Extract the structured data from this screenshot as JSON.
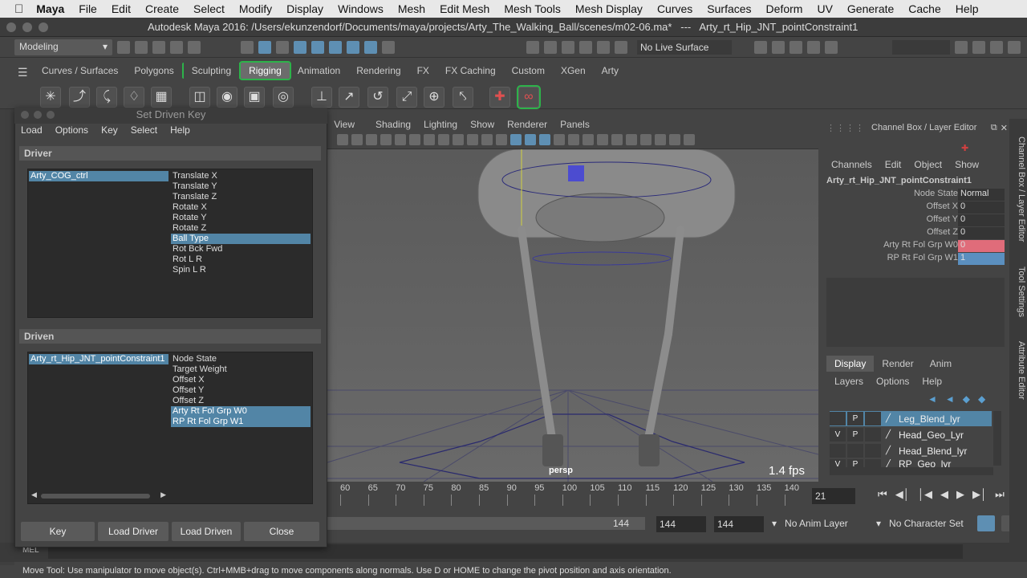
{
  "mac": {
    "app": "Maya",
    "menus": [
      "File",
      "Edit",
      "Create",
      "Select",
      "Modify",
      "Display",
      "Windows",
      "Mesh",
      "Edit Mesh",
      "Mesh Tools",
      "Mesh Display",
      "Curves",
      "Surfaces",
      "Deform",
      "UV",
      "Generate",
      "Cache",
      "Help"
    ]
  },
  "window": {
    "title": "Autodesk Maya 2016: /Users/ekunzendorf/Documents/maya/projects/Arty_The_Walking_Ball/scenes/m02-06.ma*   ---   Arty_rt_Hip_JNT_pointConstraint1"
  },
  "status": {
    "mode": "Modeling",
    "live_surface": "No Live Surface"
  },
  "shelf": {
    "tabs": [
      "Curves / Surfaces",
      "Polygons",
      "Sculpting",
      "Rigging",
      "Animation",
      "Rendering",
      "FX",
      "FX Caching",
      "Custom",
      "XGen",
      "Arty"
    ],
    "selected": "Rigging"
  },
  "viewport": {
    "menus": [
      "View",
      "Shading",
      "Lighting",
      "Show",
      "Renderer",
      "Panels"
    ],
    "camera": "persp",
    "fps": "1.4 fps"
  },
  "timeline": {
    "ticks": [
      "60",
      "65",
      "70",
      "75",
      "80",
      "85",
      "90",
      "95",
      "100",
      "105",
      "110",
      "115",
      "120",
      "125",
      "130",
      "135",
      "140"
    ],
    "current": "21"
  },
  "range": {
    "start_end": "144",
    "field1": "144",
    "field2": "144",
    "anim_layer": "No Anim Layer",
    "char_set": "No Character Set"
  },
  "mel": {
    "label": "MEL"
  },
  "help": "Move Tool: Use manipulator to move object(s). Ctrl+MMB+drag to move components along normals. Use D or HOME to change the pivot position and axis orientation.",
  "channelbox": {
    "title": "Channel Box / Layer Editor",
    "menus": [
      "Channels",
      "Edit",
      "Object",
      "Show"
    ],
    "node": "Arty_rt_Hip_JNT_pointConstraint1",
    "attrs": [
      {
        "name": "Node State",
        "value": "Normal"
      },
      {
        "name": "Offset X",
        "value": "0"
      },
      {
        "name": "Offset Y",
        "value": "0"
      },
      {
        "name": "Offset Z",
        "value": "0"
      },
      {
        "name": "Arty Rt Fol Grp W0",
        "value": "0"
      },
      {
        "name": "RP Rt Fol Grp W1",
        "value": "1"
      }
    ]
  },
  "layers": {
    "tabs": [
      "Display",
      "Render",
      "Anim"
    ],
    "menus": [
      "Layers",
      "Options",
      "Help"
    ],
    "rows": [
      {
        "v": "",
        "p": "P",
        "name": "Leg_Blend_lyr"
      },
      {
        "v": "V",
        "p": "P",
        "name": "Head_Geo_Lyr"
      },
      {
        "v": "",
        "p": "",
        "name": "Head_Blend_lyr"
      },
      {
        "v": "V",
        "p": "P",
        "name": "RP_Geo_lyr"
      }
    ]
  },
  "sidetabs": [
    "Channel Box / Layer Editor",
    "Tool Settings",
    "Attribute Editor"
  ],
  "sdk": {
    "title": "Set Driven Key",
    "menus": [
      "Load",
      "Options",
      "Key",
      "Select",
      "Help"
    ],
    "driver_label": "Driver",
    "driver_object": "Arty_COG_ctrl",
    "driver_attrs": [
      "Translate X",
      "Translate Y",
      "Translate Z",
      "Rotate X",
      "Rotate Y",
      "Rotate Z",
      "Ball Type",
      "Rot Bck Fwd",
      "Rot L R",
      "Spin L R"
    ],
    "driver_selected": "Ball Type",
    "driven_label": "Driven",
    "driven_object": "Arty_rt_Hip_JNT_pointConstraint1",
    "driven_attrs": [
      "Node State",
      "Target Weight",
      "Offset X",
      "Offset Y",
      "Offset Z",
      "Arty Rt Fol Grp W0",
      "RP Rt Fol Grp W1"
    ],
    "driven_selected": [
      "Arty Rt Fol Grp W0",
      "RP Rt Fol Grp W1"
    ],
    "buttons": [
      "Key",
      "Load Driver",
      "Load Driven",
      "Close"
    ]
  },
  "colors": {
    "selection": "#5285a6",
    "shelf_highlight": "#2db34a",
    "attr_pink": "#e06c7a",
    "attr_blue": "#5b8fbf"
  }
}
